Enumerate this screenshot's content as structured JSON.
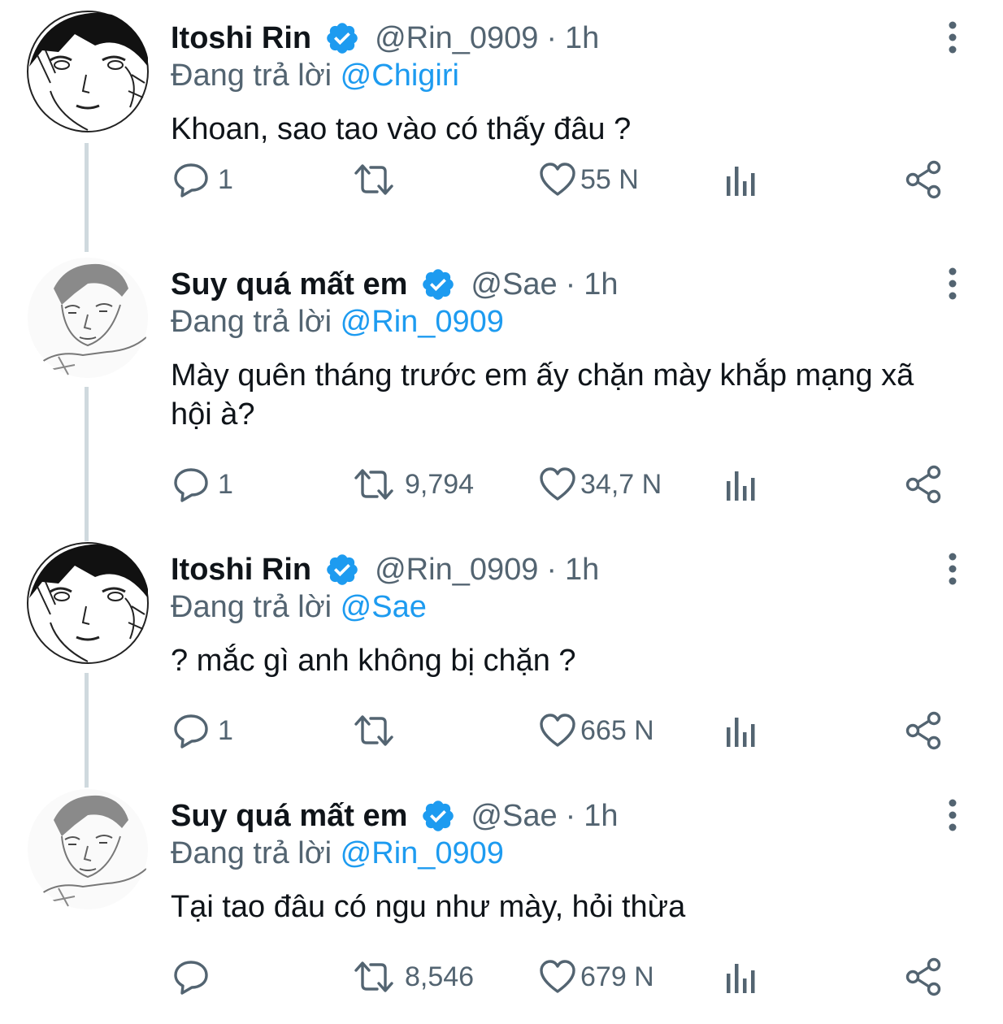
{
  "colors": {
    "text_primary": "#0f1419",
    "text_secondary": "#536471",
    "mention": "#1d9bf0",
    "verified": "#1d9bf0",
    "thread_line": "#cfd9de"
  },
  "icons": {
    "reply": "speech-bubble",
    "retweet": "retweet-arrows",
    "like": "heart-outline",
    "views": "bar-chart",
    "share": "share-nodes",
    "more": "vertical-ellipsis",
    "verified": "verified-badge"
  },
  "tweets": [
    {
      "name": "Itoshi Rin",
      "handle": "@Rin_0909",
      "separator": "·",
      "time": "1h",
      "reply_prefix": "Đang trả lời",
      "reply_to": "@Chigiri",
      "text": "Khoan, sao tao vào có thấy đâu ?",
      "replies": "1",
      "retweets": "",
      "likes": "55 N"
    },
    {
      "name": "Suy quá mất em",
      "handle": "@Sae",
      "separator": "·",
      "time": "1h",
      "reply_prefix": "Đang trả lời",
      "reply_to": "@Rin_0909",
      "text": "Mày quên tháng trước em ấy chặn mày khắp mạng xã hội à?",
      "replies": "1",
      "retweets": "9,794",
      "likes": "34,7 N"
    },
    {
      "name": "Itoshi Rin",
      "handle": "@Rin_0909",
      "separator": "·",
      "time": "1h",
      "reply_prefix": "Đang trả lời",
      "reply_to": "@Sae",
      "text": "? mắc gì anh không bị chặn ?",
      "replies": "1",
      "retweets": "",
      "likes": "665 N"
    },
    {
      "name": "Suy quá mất em",
      "handle": "@Sae",
      "separator": "·",
      "time": "1h",
      "reply_prefix": "Đang trả lời",
      "reply_to": "@Rin_0909",
      "text": "Tại tao đâu có ngu như mày, hỏi thừa",
      "replies": "",
      "retweets": "8,546",
      "likes": "679 N"
    }
  ]
}
